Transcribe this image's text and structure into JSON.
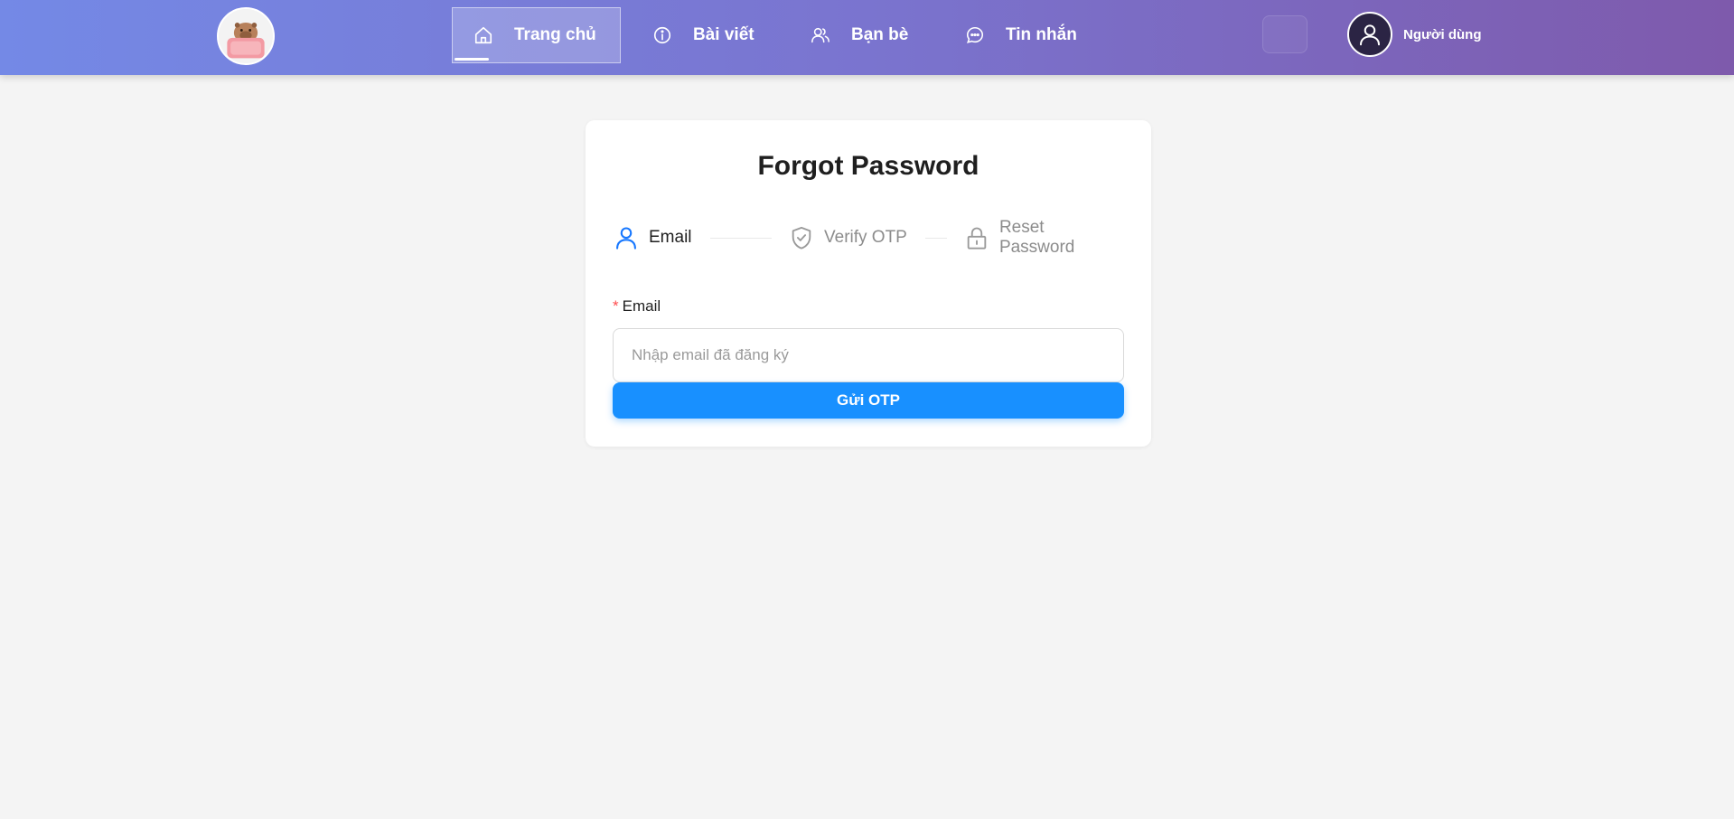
{
  "header": {
    "logo_icon": "capybara-logo",
    "nav": [
      {
        "label": "Trang chủ",
        "icon": "home-icon",
        "active": true
      },
      {
        "label": "Bài viết",
        "icon": "info-icon",
        "active": false
      },
      {
        "label": "Bạn bè",
        "icon": "friends-icon",
        "active": false
      },
      {
        "label": "Tin nhắn",
        "icon": "message-icon",
        "active": false
      }
    ],
    "user": {
      "name": "Người dùng",
      "icon": "user-icon"
    }
  },
  "form": {
    "title": "Forgot Password",
    "steps": [
      {
        "label": "Email",
        "icon": "user-icon",
        "status": "current"
      },
      {
        "label": "Verify OTP",
        "icon": "shield-check-icon",
        "status": "wait"
      },
      {
        "label": "Reset Password",
        "icon": "lock-icon",
        "status": "wait"
      }
    ],
    "email_label": "Email",
    "required_mark": "*",
    "email_placeholder": "Nhập email đã đăng ký",
    "email_value": "",
    "submit_label": "Gửi OTP"
  },
  "colors": {
    "primary": "#1890ff",
    "header_gradient_start": "#7489e6",
    "header_gradient_end": "#7e5aac",
    "required": "#ff4d4f",
    "background": "#f4f4f4"
  }
}
